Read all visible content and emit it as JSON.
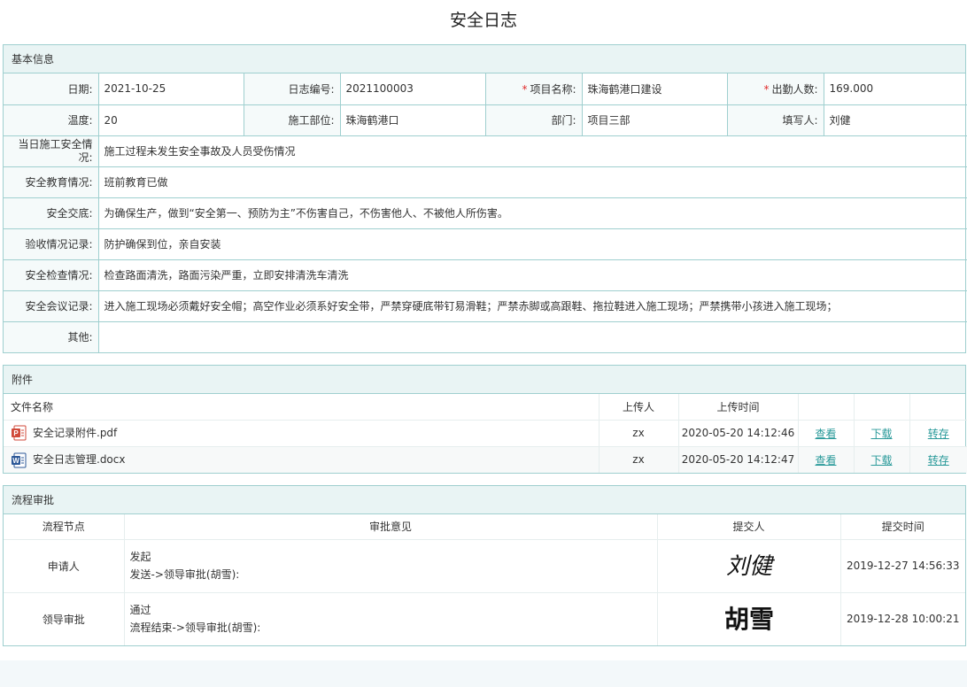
{
  "page_title": "安全日志",
  "basic": {
    "header": "基本信息",
    "row1": [
      {
        "label": "日期:",
        "value": "2021-10-25",
        "required": false
      },
      {
        "label": "日志编号:",
        "value": "2021100003",
        "required": false
      },
      {
        "label": "项目名称:",
        "value": "珠海鹤港口建设",
        "required": true
      },
      {
        "label": "出勤人数:",
        "value": "169.000",
        "required": true
      }
    ],
    "row2": [
      {
        "label": "温度:",
        "value": "20"
      },
      {
        "label": "施工部位:",
        "value": "珠海鹤港口"
      },
      {
        "label": "部门:",
        "value": "项目三部"
      },
      {
        "label": "填写人:",
        "value": "刘健"
      }
    ],
    "required_mark": "*",
    "long_rows": [
      {
        "label": "当日施工安全情况:",
        "value": "施工过程未发生安全事故及人员受伤情况"
      },
      {
        "label": "安全教育情况:",
        "value": "班前教育已做"
      },
      {
        "label": "安全交底:",
        "value": "为确保生产，做到“安全第一、预防为主”不伤害自己，不伤害他人、不被他人所伤害。"
      },
      {
        "label": "验收情况记录:",
        "value": "防护确保到位，亲自安装"
      },
      {
        "label": "安全检查情况:",
        "value": "检查路面清洗，路面污染严重，立即安排清洗车清洗"
      },
      {
        "label": "安全会议记录:",
        "value": "进入施工现场必须戴好安全帽；高空作业必须系好安全带，严禁穿硬底带钉易滑鞋；严禁赤脚或高跟鞋、拖拉鞋进入施工现场；严禁携带小孩进入施工现场；"
      },
      {
        "label": "其他:",
        "value": ""
      }
    ]
  },
  "attachments": {
    "header": "附件",
    "columns": [
      "文件名称",
      "上传人",
      "上传时间",
      "",
      "",
      ""
    ],
    "rows": [
      {
        "icon": "pdf-file-icon",
        "name": "安全记录附件.pdf",
        "uploader": "zx",
        "time": "2020-05-20 14:12:46",
        "view": "查看",
        "download": "下载",
        "transfer": "转存"
      },
      {
        "icon": "word-file-icon",
        "name": "安全日志管理.docx",
        "uploader": "zx",
        "time": "2020-05-20 14:12:47",
        "view": "查看",
        "download": "下载",
        "transfer": "转存"
      }
    ]
  },
  "workflow": {
    "header": "流程审批",
    "columns": [
      "流程节点",
      "审批意见",
      "提交人",
      "提交时间"
    ],
    "rows": [
      {
        "node": "申请人",
        "opinion": "发起",
        "detail": "发送->领导审批(胡雪):",
        "signature": "刘健",
        "time": "2019-12-27 14:56:33"
      },
      {
        "node": "领导审批",
        "opinion": "通过",
        "detail": "流程结束->领导审批(胡雪):",
        "signature": "胡雪",
        "time": "2019-12-28 10:00:21"
      }
    ]
  },
  "colors": {
    "border": "#9fcfcf",
    "header_bg": "#e9f4f4",
    "link": "#2a9a9a",
    "required": "#e02b2b"
  }
}
